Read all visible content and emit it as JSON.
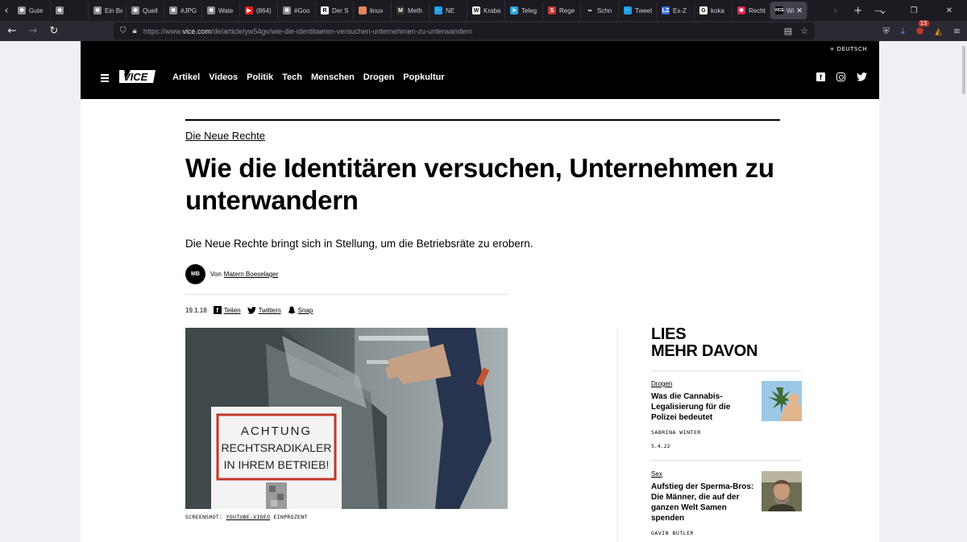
{
  "browser": {
    "tabs": [
      {
        "label": "Gute",
        "color": "#8a8a94",
        "glyph": "✱"
      },
      {
        "label": "",
        "color": "#8a8a94",
        "glyph": "✱"
      },
      {
        "label": "Ein Be",
        "color": "#8a8a94",
        "glyph": "✱"
      },
      {
        "label": "Quell",
        "color": "#8a8a94",
        "glyph": "✱"
      },
      {
        "label": "#JPG",
        "color": "#8a8a94",
        "glyph": "✱"
      },
      {
        "label": "Wate",
        "color": "#8a8a94",
        "glyph": "✱"
      },
      {
        "label": "(864)",
        "color": "#e62117",
        "glyph": "▶"
      },
      {
        "label": "#Goo",
        "color": "#8a8a94",
        "glyph": "✱"
      },
      {
        "label": "Der S",
        "color": "#ffffff",
        "glyph": "R"
      },
      {
        "label": "linux",
        "color": "#e8825a",
        "glyph": ""
      },
      {
        "label": "Meth",
        "color": "#333333",
        "glyph": "M"
      },
      {
        "label": "NE",
        "color": "#1d9bf0",
        "glyph": "🐦"
      },
      {
        "label": "Kraba",
        "color": "#ffffff",
        "glyph": "W"
      },
      {
        "label": "Teleg",
        "color": "#2aa3df",
        "glyph": "➤"
      },
      {
        "label": "Rege",
        "color": "#c0392b",
        "glyph": "S"
      },
      {
        "label": "Schn",
        "color": "#1c1b22",
        "glyph": "∞"
      },
      {
        "label": "Tweet",
        "color": "#1d9bf0",
        "glyph": "🐦"
      },
      {
        "label": "Ex-Z",
        "color": "#3b6fd8",
        "glyph": "LZ"
      },
      {
        "label": "koka",
        "color": "#ffffff",
        "glyph": "G"
      },
      {
        "label": "Recht",
        "color": "#d6254a",
        "glyph": "✱"
      }
    ],
    "active_tab": {
      "label": "Wi",
      "close": "✕"
    },
    "url_prefix": "https://www.",
    "url_domain": "vice.com",
    "url_path": "/de/article/yw54gv/wie-die-identitaeren-versuchen-unternehmen-zu-unterwandern",
    "notification_count": "15"
  },
  "vice": {
    "language": "+ DEUTSCH",
    "nav": [
      "Artikel",
      "Videos",
      "Politik",
      "Tech",
      "Menschen",
      "Drogen",
      "Popkultur"
    ]
  },
  "article": {
    "kicker": "Die Neue Rechte",
    "headline": "Wie die Identitären versuchen, Unternehmen zu unterwandern",
    "dek": "Die Neue Rechte bringt sich in Stellung, um die Betriebsräte zu erobern.",
    "author_initials": "MB",
    "by": "Von",
    "author": "Matern Boeselager",
    "date": "19.1.18",
    "share": {
      "facebook": "Teilen",
      "twitter": "Twittern",
      "snap": "Snap"
    },
    "image_sign": [
      "ACHTUNG",
      "RECHTSRADIKALER",
      "IN IHREM BETRIEB!"
    ],
    "caption_prefix": "SCREENSHOT: ",
    "caption_link": "YOUTUBE-VIDEO",
    "caption_suffix": " EINPROZENT"
  },
  "sidebar": {
    "heading_line1": "LIES",
    "heading_line2": "MEHR DAVON",
    "cards": [
      {
        "category": "Drogen",
        "title": "Was die Cannabis-Legalisierung für die Polizei bedeutet",
        "author": "SABRINA WINTER",
        "date": "5.4.22"
      },
      {
        "category": "Sex",
        "title": "Aufstieg der Sperma-Bros: Die Männer, die auf der ganzen Welt Samen spenden",
        "author": "GAVIN BUTLER",
        "date": ""
      }
    ]
  }
}
